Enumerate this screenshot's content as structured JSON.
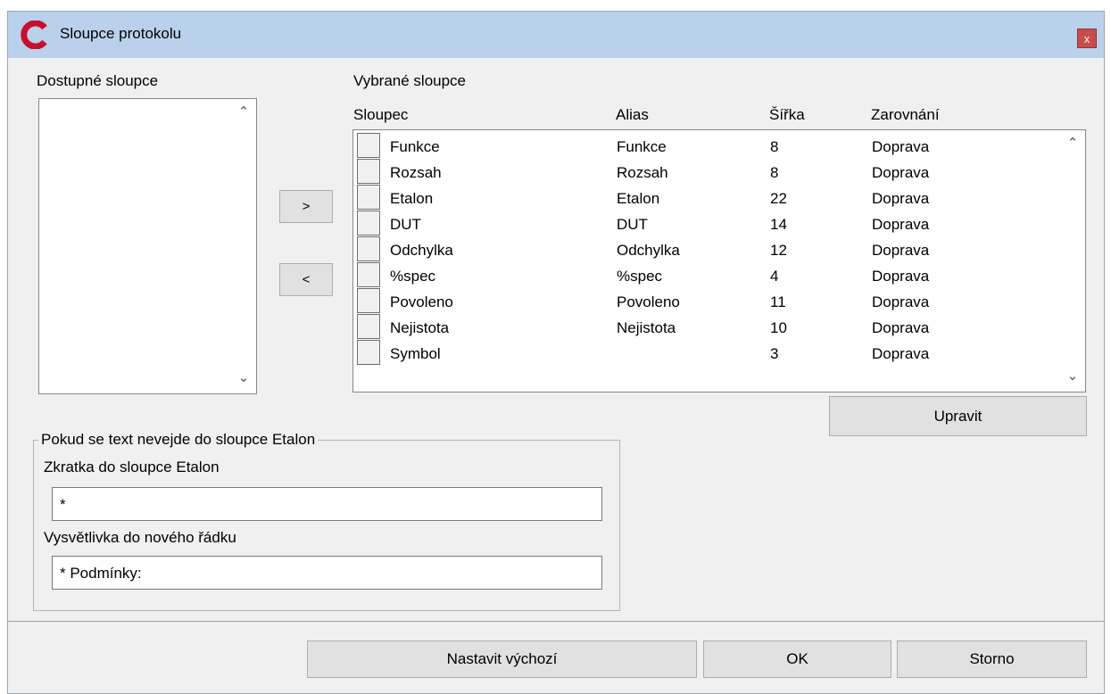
{
  "window": {
    "title": "Sloupce protokolu",
    "close_label": "x"
  },
  "available": {
    "label": "Dostupné sloupce",
    "items": []
  },
  "transfer": {
    "add_label": ">",
    "remove_label": "<"
  },
  "selected": {
    "label": "Vybrané sloupce",
    "columns": {
      "col": "Sloupec",
      "alias": "Alias",
      "width": "Šířka",
      "align": "Zarovnání"
    },
    "rows": [
      {
        "name": "Funkce",
        "alias": "Funkce",
        "width": "8",
        "align": "Doprava"
      },
      {
        "name": "Rozsah",
        "alias": "Rozsah",
        "width": "8",
        "align": "Doprava"
      },
      {
        "name": "Etalon",
        "alias": "Etalon",
        "width": "22",
        "align": "Doprava"
      },
      {
        "name": "DUT",
        "alias": "DUT",
        "width": "14",
        "align": "Doprava"
      },
      {
        "name": "Odchylka",
        "alias": "Odchylka",
        "width": "12",
        "align": "Doprava"
      },
      {
        "name": "%spec",
        "alias": "%spec",
        "width": "4",
        "align": "Doprava"
      },
      {
        "name": "Povoleno",
        "alias": "Povoleno",
        "width": "11",
        "align": "Doprava"
      },
      {
        "name": "Nejistota",
        "alias": "Nejistota",
        "width": "10",
        "align": "Doprava"
      },
      {
        "name": "Symbol",
        "alias": "",
        "width": "3",
        "align": "Doprava"
      }
    ],
    "edit_label": "Upravit"
  },
  "overflow": {
    "legend": "Pokud se text nevejde do sloupce Etalon",
    "abbrev_label": "Zkratka do sloupce Etalon",
    "abbrev_value": "*",
    "note_label": "Vysvětlivka do nového řádku",
    "note_value": "* Podmínky:"
  },
  "footer": {
    "default_label": "Nastavit výchozí",
    "ok_label": "OK",
    "cancel_label": "Storno"
  },
  "colors": {
    "titlebar": "#b9d1ea",
    "logo_red": "#c8102e",
    "close_red": "#c74c4c"
  }
}
